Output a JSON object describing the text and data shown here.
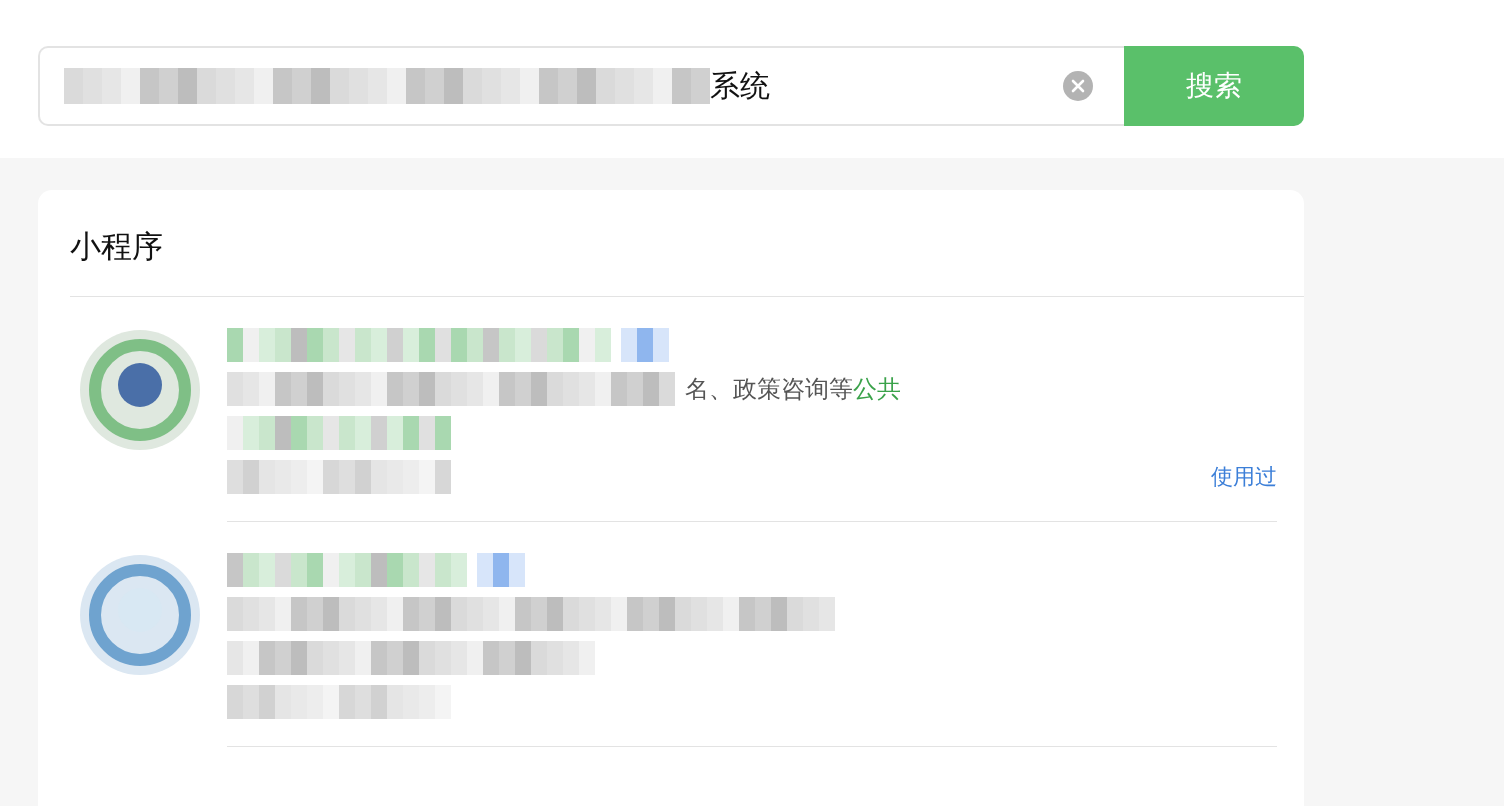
{
  "search": {
    "value": "系统",
    "button": "搜索"
  },
  "section": {
    "title": "小程序",
    "items": [
      {
        "kind": "partial",
        "desc_text": "名、政策咨询等",
        "desc_highlight": "公共",
        "badge": "使用过"
      },
      {
        "kind": "hidden"
      }
    ]
  }
}
